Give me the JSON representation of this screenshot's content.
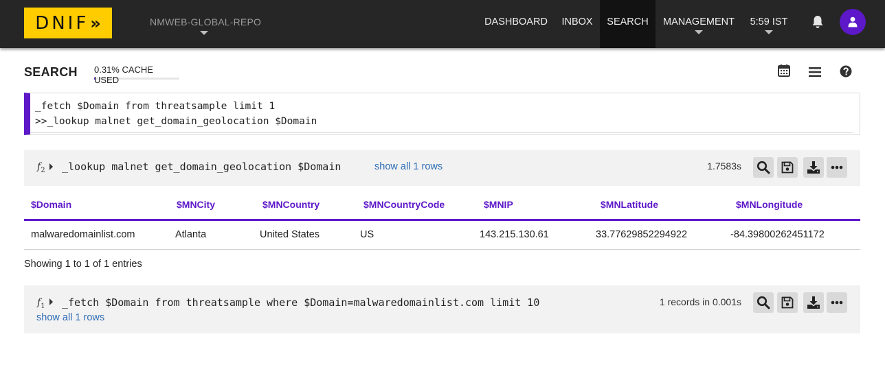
{
  "app": {
    "logo_text": "DNIF",
    "repo": "NMWEB-GLOBAL-REPO"
  },
  "nav": {
    "dashboard": "DASHBOARD",
    "inbox": "INBOX",
    "search": "SEARCH",
    "management": "MANAGEMENT",
    "time": "5:59 IST"
  },
  "search": {
    "title": "SEARCH",
    "cache": "0.31% CACHE USED",
    "cache_used_percent": 0.31
  },
  "editor": {
    "lines": [
      "_fetch $Domain from threatsample limit 1",
      ">>_lookup malnet get_domain_geolocation $Domain"
    ]
  },
  "results": [
    {
      "fn": "f",
      "index": "2",
      "query": "_lookup malnet get_domain_geolocation $Domain",
      "show_all": "show all 1 rows",
      "timing": "1.7583s",
      "columns": [
        "$Domain",
        "$MNCity",
        "$MNCountry",
        "$MNCountryCode",
        "$MNIP",
        "$MNLatitude",
        "$MNLongitude"
      ],
      "rows": [
        [
          "malwaredomainlist.com",
          "Atlanta",
          "United States",
          "US",
          "143.215.130.61",
          "33.77629852294922",
          "-84.39800262451172"
        ]
      ],
      "showing": "Showing 1 to 1 of 1 entries"
    },
    {
      "fn": "f",
      "index": "1",
      "query": "_fetch $Domain from threatsample where $Domain=malwaredomainlist.com limit 10",
      "show_all": "show all 1 rows",
      "timing": "1 records in 0.001s"
    }
  ],
  "colors": {
    "accent": "#5d18c9",
    "logo": "#ffcc00",
    "topbar": "#262626",
    "link": "#2f6db5"
  },
  "icons": {
    "calendar": "calendar-icon",
    "menu": "hamburger-icon",
    "help": "help-icon",
    "bell": "bell-icon",
    "user": "user-icon",
    "search": "search-icon",
    "save": "save-icon",
    "download": "download-icon",
    "more": "more-icon"
  }
}
